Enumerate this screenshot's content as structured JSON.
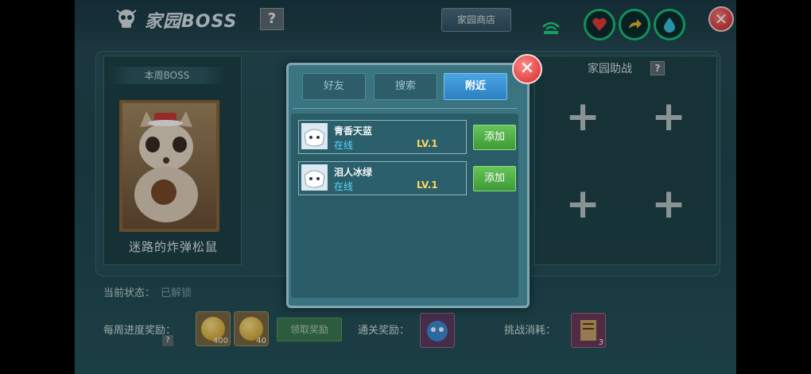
{
  "header": {
    "title": "家园BOSS",
    "help_label": "?",
    "shop_label": "家园商店",
    "close_label": "✕"
  },
  "boss": {
    "ribbon": "本周BOSS",
    "name": "迷路的炸弹松鼠"
  },
  "assist": {
    "title": "家园助战",
    "help_label": "?",
    "slot_label": "+"
  },
  "status": {
    "label": "当前状态：",
    "value": "已解锁"
  },
  "rewards": {
    "weekly_label": "每周进度奖励：",
    "weekly_help": "?",
    "coin1_count": "400",
    "coin2_count": "40",
    "claim_label": "领取奖励",
    "clear_label": "通关奖励：",
    "cost_label": "挑战消耗：",
    "cost_count": "3"
  },
  "dialog": {
    "tabs": [
      {
        "label": "好友"
      },
      {
        "label": "搜索"
      },
      {
        "label": "附近"
      }
    ],
    "active_tab": 2,
    "close_label": "✕",
    "friends": [
      {
        "name": "青香天蓝",
        "status": "在线",
        "level": "LV.1",
        "add_label": "添加"
      },
      {
        "name": "泪人冰绿",
        "status": "在线",
        "level": "LV.1",
        "add_label": "添加"
      }
    ]
  },
  "colors": {
    "accent_blue": "#3d8fd0",
    "online": "#57d8ff",
    "level": "#ffd85a",
    "add_green": "#4caa42"
  }
}
